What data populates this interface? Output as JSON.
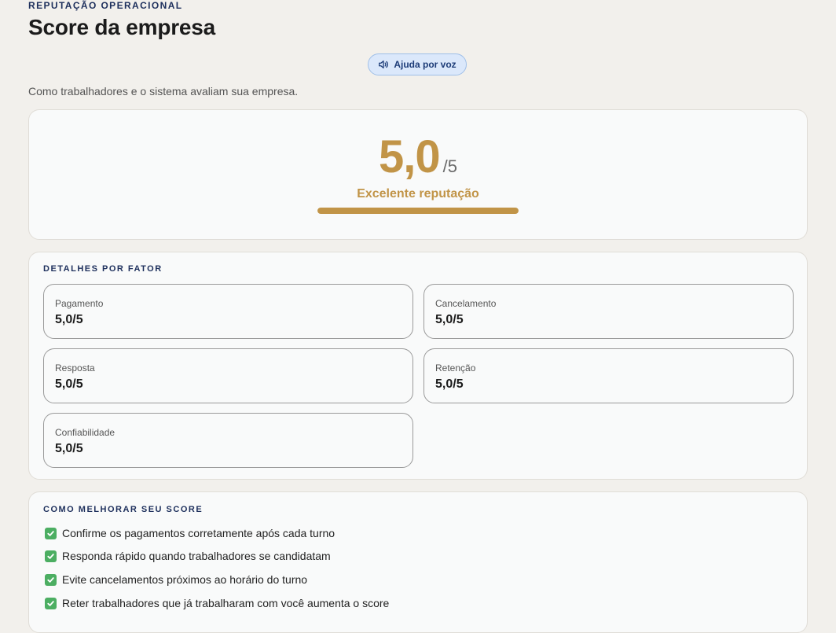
{
  "header": {
    "eyebrow": "REPUTAÇÃO OPERACIONAL",
    "title": "Score da empresa",
    "voice_help_label": "Ajuda por voz",
    "subtitle": "Como trabalhadores e o sistema avaliam sua empresa."
  },
  "score": {
    "value": "5,0",
    "max": "/5",
    "label": "Excelente reputação",
    "progress_fraction": 1.0
  },
  "factors": {
    "heading": "DETALHES POR FATOR",
    "items": [
      {
        "label": "Pagamento",
        "value": "5,0/5"
      },
      {
        "label": "Cancelamento",
        "value": "5,0/5"
      },
      {
        "label": "Resposta",
        "value": "5,0/5"
      },
      {
        "label": "Retenção",
        "value": "5,0/5"
      },
      {
        "label": "Confiabilidade",
        "value": "5,0/5"
      }
    ]
  },
  "tips": {
    "heading": "COMO MELHORAR SEU SCORE",
    "icon": "check-box-icon",
    "items": [
      "Confirme os pagamentos corretamente após cada turno",
      "Responda rápido quando trabalhadores se candidatam",
      "Evite cancelamentos próximos ao horário do turno",
      "Reter trabalhadores que já trabalharam com você aumenta o score"
    ]
  },
  "colors": {
    "accent_gold": "#c19447",
    "heading_navy": "#1d2f5c",
    "voice_button_bg": "#dbe8fb",
    "check_green": "#4cae62"
  }
}
